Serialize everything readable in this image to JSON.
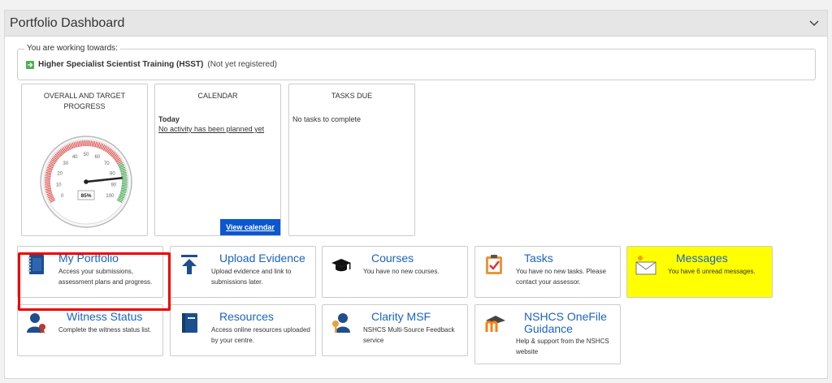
{
  "panel": {
    "title": "Portfolio Dashboard"
  },
  "working": {
    "legend": "You are working towards:",
    "programme": "Higher Specialist Scientist Training (HSST)",
    "status": "(Not yet registered)"
  },
  "progress": {
    "title": "OVERALL AND TARGET PROGRESS",
    "percent_label": "85%",
    "value": 85,
    "ticks": [
      "0",
      "10",
      "20",
      "30",
      "40",
      "50",
      "60",
      "70",
      "80",
      "90",
      "100"
    ]
  },
  "calendar": {
    "title": "CALENDAR",
    "today": "Today",
    "none": "No activity has been planned yet",
    "button": "View calendar"
  },
  "tasks_due": {
    "title": "TASKS DUE",
    "none": "No tasks to complete"
  },
  "tiles": {
    "portfolio": {
      "title": "My Portfolio",
      "desc1": "Access your submissions,",
      "desc2": "assessment plans and progress."
    },
    "upload": {
      "title": "Upload Evidence",
      "desc1": "Upload evidence and link to",
      "desc2": "submissions later."
    },
    "courses": {
      "title": "Courses",
      "desc1": "You have no new courses."
    },
    "tasks": {
      "title": "Tasks",
      "desc1": "You have no new tasks. Please",
      "desc2": "contact your assessor."
    },
    "messages": {
      "title": "Messages",
      "desc1": "You have 6 unread messages."
    },
    "witness": {
      "title": "Witness Status",
      "desc1": "Complete the witness status list."
    },
    "resources": {
      "title": "Resources",
      "desc1": "Access online resources uploaded",
      "desc2": "by your centre."
    },
    "clarity": {
      "title": "Clarity MSF",
      "desc1": "NSHCS Multi-Source Feedback",
      "desc2": "service"
    },
    "guidance": {
      "title1": "NSHCS OneFile",
      "title2": "Guidance",
      "desc1": "Help & support from the NSHCS",
      "desc2": "website"
    }
  },
  "colors": {
    "link_blue": "#1a63c6",
    "messages_bg": "#ffff00",
    "gauge_red": "#d9534f",
    "gauge_green": "#3fa34d",
    "button_blue": "#0b57d0"
  }
}
